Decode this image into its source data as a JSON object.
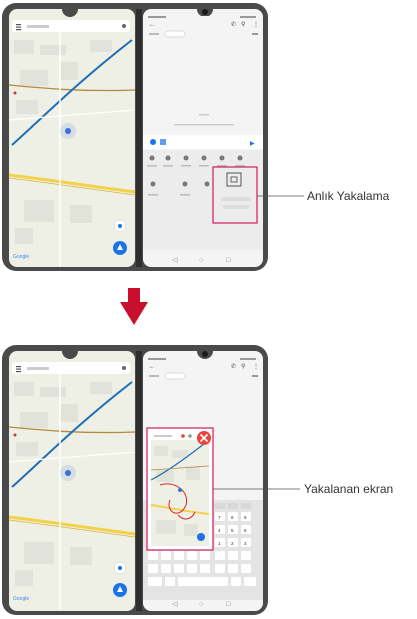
{
  "labels": {
    "capture": "Anlık Yakalama",
    "captured_screen": "Yakalanan ekran"
  },
  "colors": {
    "arrow": "#c8102e",
    "callout_box": "#d6286b",
    "device_frame": "#4a4a4a",
    "screen_bg": "#f2f2f2",
    "map_bg": "#eef0e6",
    "road_yellow": "#f3d24a",
    "road_blue": "#1e6fb8",
    "road_brown": "#b38a3c",
    "accent_blue": "#1a73e8",
    "red_button": "#e8453c"
  },
  "icons": [
    "menu-icon",
    "mic-icon",
    "phone-icon",
    "search-icon",
    "more-icon",
    "back-icon",
    "capture-icon",
    "close-icon",
    "location-icon",
    "navigation-icon",
    "google-logo"
  ]
}
